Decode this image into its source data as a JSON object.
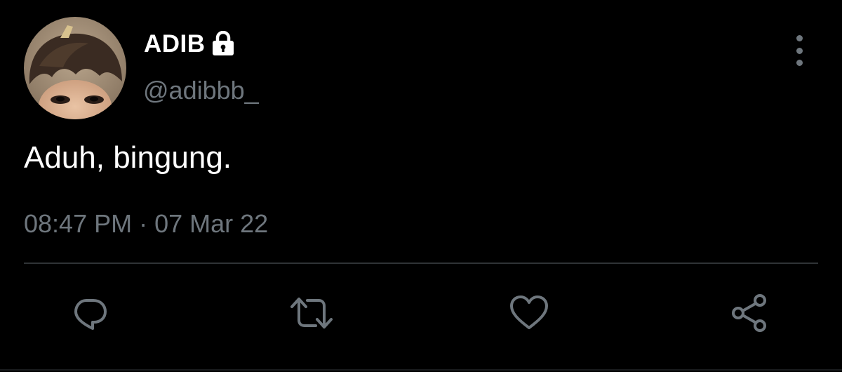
{
  "user": {
    "display_name": "ADIB",
    "handle": "@adibbb_",
    "protected_icon": "lock-icon"
  },
  "tweet": {
    "text": "Aduh, bingung.",
    "time": "08:47 PM",
    "separator": "·",
    "date": "07 Mar 22"
  },
  "actions": [
    {
      "icon": "reply-icon"
    },
    {
      "icon": "retweet-icon"
    },
    {
      "icon": "like-icon"
    },
    {
      "icon": "share-icon"
    }
  ],
  "colors": {
    "background": "#000000",
    "primary_text": "#ffffff",
    "secondary_text": "#6e767d",
    "divider": "#2f3336"
  }
}
